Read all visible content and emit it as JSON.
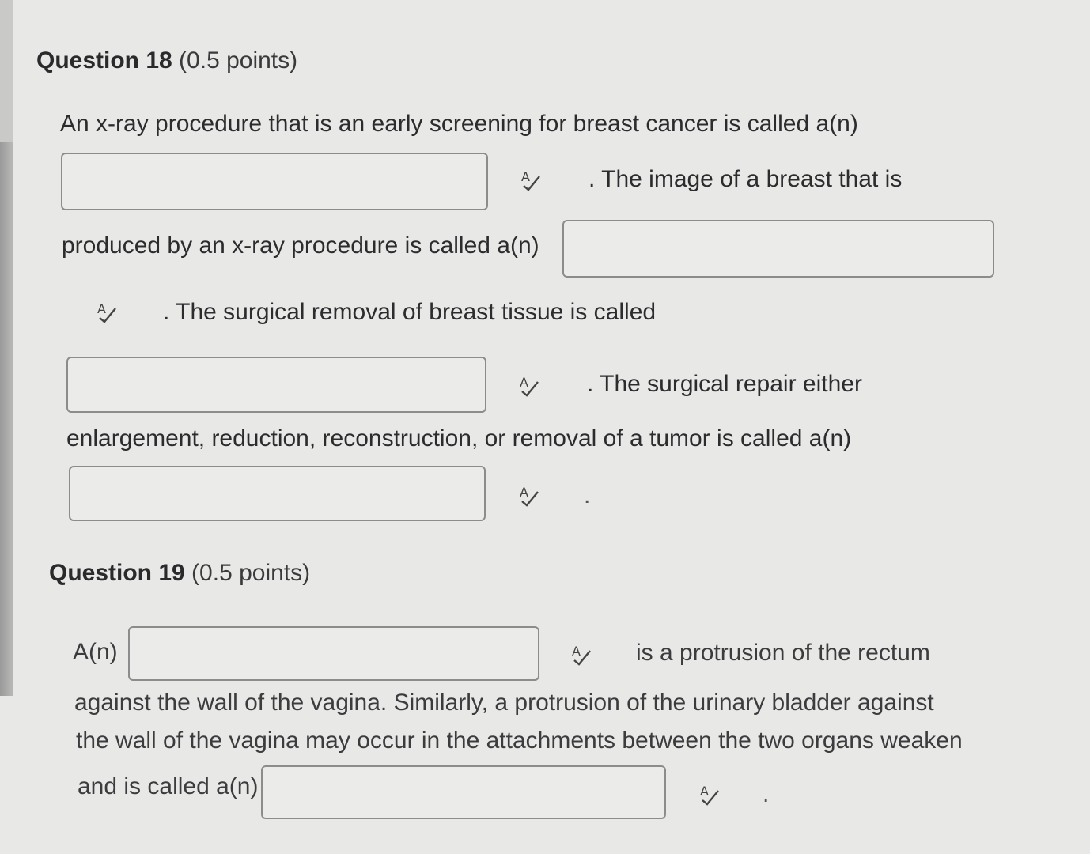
{
  "questions": [
    {
      "title_number": "Question 18",
      "title_points": " (0.5 points)",
      "lines": {
        "l1": "An x-ray procedure that is an early screening for breast cancer is called a(n)",
        "l2": ". The image of a breast that is",
        "l3": "produced by an x-ray procedure is called a(n)",
        "l4": ". The surgical removal of breast tissue is called",
        "l5": ". The surgical repair either",
        "l6": "enlargement, reduction, reconstruction, or removal of a tumor is called a(n)",
        "l7": "."
      },
      "blanks": [
        {
          "value": ""
        },
        {
          "value": ""
        },
        {
          "value": ""
        },
        {
          "value": ""
        }
      ]
    },
    {
      "title_number": "Question 19",
      "title_points": " (0.5 points)",
      "lines": {
        "l1": "A(n)",
        "l2": "is a protrusion of the rectum",
        "l3": "against the wall of the vagina. Similarly, a protrusion of the urinary bladder against",
        "l4": "the wall of the vagina may occur in the attachments between the two organs weaken",
        "l5": "and is called a(n)",
        "l6": "."
      },
      "blanks": [
        {
          "value": ""
        },
        {
          "value": ""
        }
      ]
    }
  ],
  "icons": {
    "spellcheck": "spellcheck-icon"
  }
}
